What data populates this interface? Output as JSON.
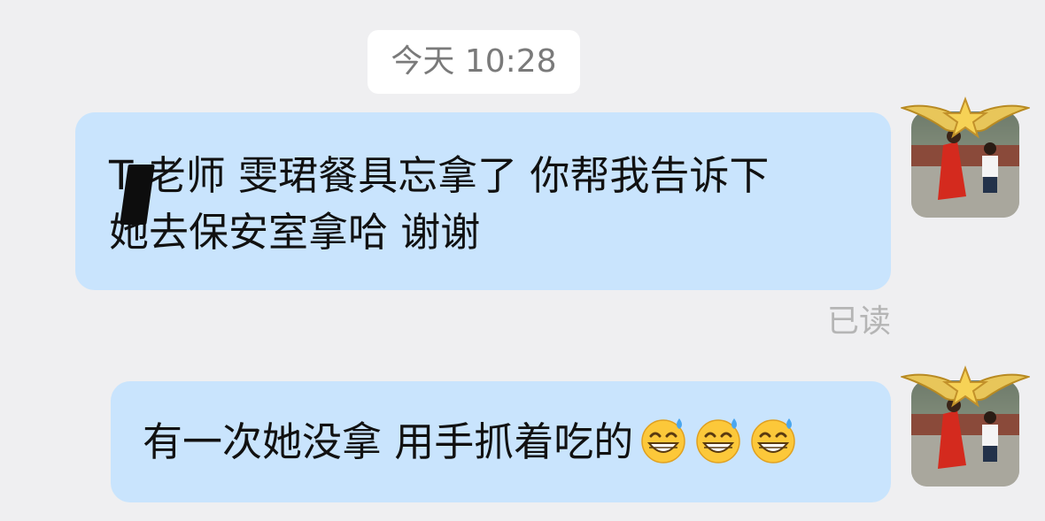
{
  "timestamp": "今天 10:28",
  "messages": [
    {
      "lines": [
        "T  老师 雯珺餐具忘拿了 你帮我告诉下",
        "她去保安室拿哈 谢谢"
      ],
      "status": "已读"
    },
    {
      "text": "有一次她没拿 用手抓着吃的",
      "emojis": [
        "grinning-sweat-emoji",
        "grinning-sweat-emoji",
        "grinning-sweat-emoji"
      ]
    }
  ],
  "colors": {
    "background": "#efeff1",
    "bubble": "#c9e4fd",
    "timestamp_bg": "#ffffff",
    "read_text": "#b5b5b5"
  }
}
